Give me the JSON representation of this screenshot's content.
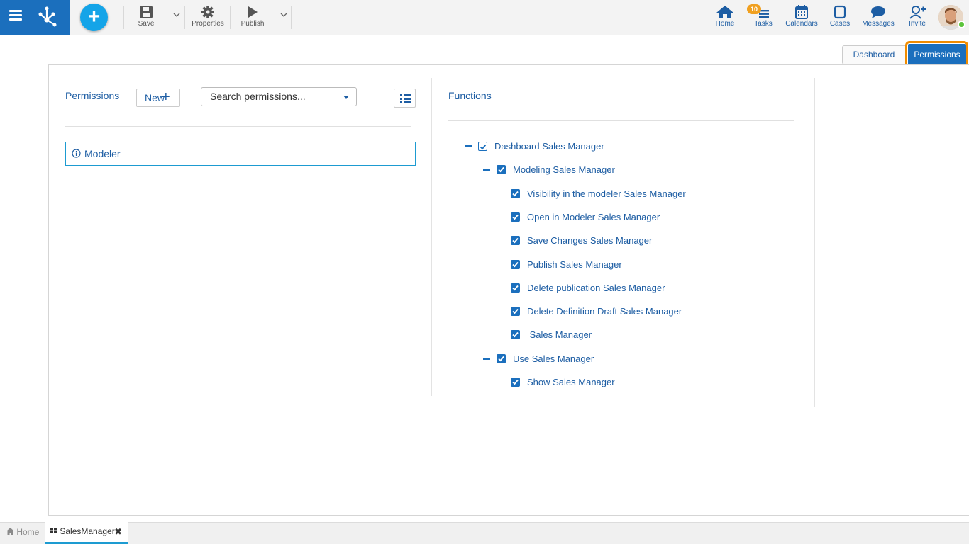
{
  "toolbar": {
    "save": "Save",
    "properties": "Properties",
    "publish": "Publish",
    "plus": "+"
  },
  "nav": {
    "home": "Home",
    "tasks": "Tasks",
    "tasks_badge": "10",
    "calendars": "Calendars",
    "cases": "Cases",
    "messages": "Messages",
    "invite": "Invite"
  },
  "tabs": {
    "dashboard": "Dashboard",
    "permissions": "Permissions"
  },
  "permissions_panel": {
    "title": "Permissions",
    "new_label": "New",
    "search_placeholder": "Search permissions...",
    "items": [
      "Modeler"
    ]
  },
  "functions_panel": {
    "title": "Functions",
    "tree": [
      {
        "label": "Dashboard Sales Manager",
        "level": 0,
        "state": "partial",
        "expanded": true
      },
      {
        "label": "Modeling Sales Manager",
        "level": 1,
        "state": "checked",
        "expanded": true
      },
      {
        "label": "Visibility in the modeler Sales Manager",
        "level": 2,
        "state": "checked"
      },
      {
        "label": "Open in Modeler Sales Manager",
        "level": 2,
        "state": "checked"
      },
      {
        "label": "Save Changes Sales Manager",
        "level": 2,
        "state": "checked"
      },
      {
        "label": "Publish Sales Manager",
        "level": 2,
        "state": "checked"
      },
      {
        "label": "Delete publication Sales Manager",
        "level": 2,
        "state": "checked"
      },
      {
        "label": "Delete Definition Draft Sales Manager",
        "level": 2,
        "state": "checked"
      },
      {
        "label": " Sales Manager",
        "level": 2,
        "state": "checked"
      },
      {
        "label": "Use Sales Manager",
        "level": 1,
        "state": "checked",
        "expanded": true
      },
      {
        "label": "Show Sales Manager",
        "level": 2,
        "state": "checked"
      }
    ]
  },
  "bottom_tabs": {
    "home": "Home",
    "current": "SalesManager"
  },
  "colors": {
    "brand": "#1b6fbd",
    "accent": "#14a4e8",
    "highlight": "#f08c00",
    "badge": "#f0a020"
  }
}
